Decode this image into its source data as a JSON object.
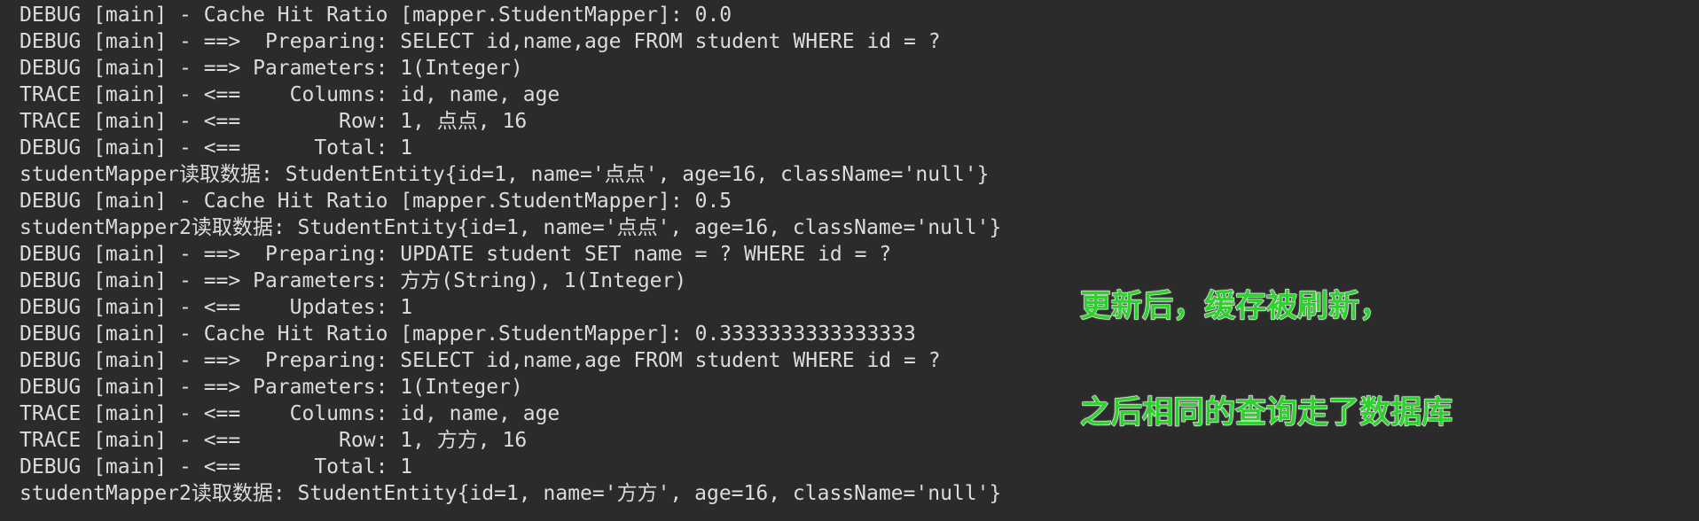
{
  "console": {
    "lines": [
      "DEBUG [main] - Cache Hit Ratio [mapper.StudentMapper]: 0.0",
      "DEBUG [main] - ==>  Preparing: SELECT id,name,age FROM student WHERE id = ?",
      "DEBUG [main] - ==> Parameters: 1(Integer)",
      "TRACE [main] - <==    Columns: id, name, age",
      "TRACE [main] - <==        Row: 1, 点点, 16",
      "DEBUG [main] - <==      Total: 1",
      "studentMapper读取数据: StudentEntity{id=1, name='点点', age=16, className='null'}",
      "DEBUG [main] - Cache Hit Ratio [mapper.StudentMapper]: 0.5",
      "studentMapper2读取数据: StudentEntity{id=1, name='点点', age=16, className='null'}",
      "DEBUG [main] - ==>  Preparing: UPDATE student SET name = ? WHERE id = ?",
      "DEBUG [main] - ==> Parameters: 方方(String), 1(Integer)",
      "DEBUG [main] - <==    Updates: 1",
      "DEBUG [main] - Cache Hit Ratio [mapper.StudentMapper]: 0.3333333333333333",
      "DEBUG [main] - ==>  Preparing: SELECT id,name,age FROM student WHERE id = ?",
      "DEBUG [main] - ==> Parameters: 1(Integer)",
      "TRACE [main] - <==    Columns: id, name, age",
      "TRACE [main] - <==        Row: 1, 方方, 16",
      "DEBUG [main] - <==      Total: 1",
      "studentMapper2读取数据: StudentEntity{id=1, name='方方', age=16, className='null'}"
    ]
  },
  "annotation": {
    "line1": "更新后，缓存被刷新，",
    "line2": "之后相同的查询走了数据库"
  },
  "colors": {
    "background": "#2b2b2b",
    "text": "#dcdcdc",
    "annotation": "#2fd02f"
  }
}
